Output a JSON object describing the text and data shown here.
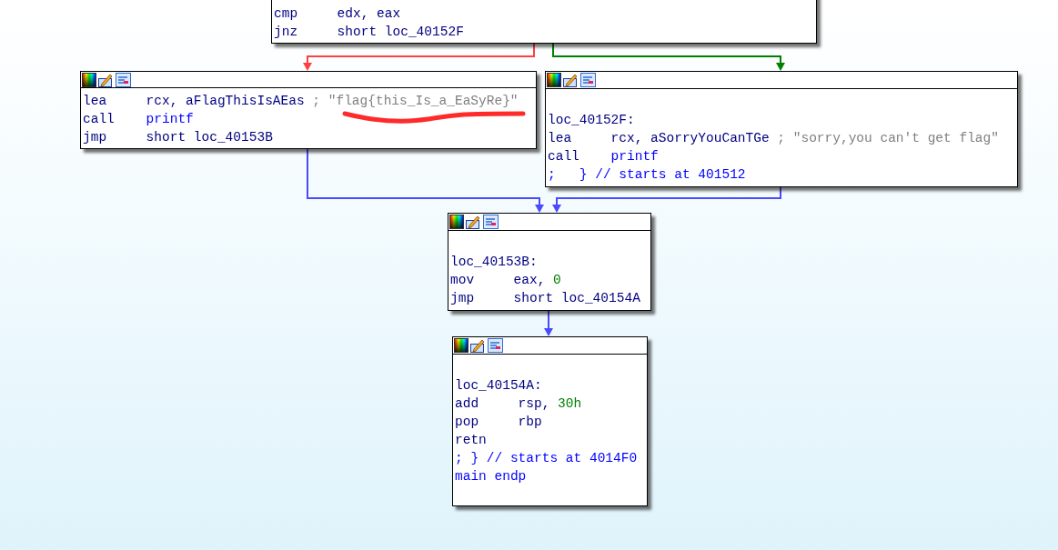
{
  "nodes": [
    {
      "lines": [
        {
          "kind": "instr",
          "mnemonic": "cmp",
          "operands": [
            {
              "text": "edx, eax",
              "kind": "plain"
            }
          ]
        },
        {
          "kind": "instr",
          "mnemonic": "jnz",
          "operands": [
            {
              "text": "short loc_40152F",
              "kind": "plain"
            }
          ]
        }
      ]
    },
    {
      "lines": [
        {
          "kind": "instr",
          "mnemonic": "lea",
          "operands": [
            {
              "text": "rcx, aFlagThisIsAEas",
              "kind": "plain"
            }
          ],
          "comment": "; \"flag{this_Is_a_EaSyRe}\""
        },
        {
          "kind": "instr",
          "mnemonic": "call",
          "operands": [
            {
              "text": "printf",
              "kind": "func"
            }
          ]
        },
        {
          "kind": "instr",
          "mnemonic": "jmp",
          "operands": [
            {
              "text": "short loc_40153B",
              "kind": "plain"
            }
          ]
        }
      ]
    },
    {
      "lines": [
        {
          "kind": "blank"
        },
        {
          "kind": "label",
          "text": "loc_40152F:"
        },
        {
          "kind": "instr",
          "mnemonic": "lea",
          "operands": [
            {
              "text": "rcx, aSorryYouCanTGe",
              "kind": "plain"
            }
          ],
          "comment": "; \"sorry,you can't get flag\""
        },
        {
          "kind": "instr",
          "mnemonic": "call",
          "operands": [
            {
              "text": "printf",
              "kind": "func"
            }
          ]
        },
        {
          "kind": "note",
          "text": ";   } // starts at 401512"
        }
      ]
    },
    {
      "lines": [
        {
          "kind": "blank"
        },
        {
          "kind": "label",
          "text": "loc_40153B:"
        },
        {
          "kind": "instr",
          "mnemonic": "mov",
          "operands": [
            {
              "text": "eax,",
              "kind": "plain"
            },
            {
              "text": "0",
              "kind": "num"
            }
          ]
        },
        {
          "kind": "instr",
          "mnemonic": "jmp",
          "operands": [
            {
              "text": "short loc_40154A",
              "kind": "plain"
            }
          ]
        }
      ]
    },
    {
      "lines": [
        {
          "kind": "blank"
        },
        {
          "kind": "label",
          "text": "loc_40154A:"
        },
        {
          "kind": "instr",
          "mnemonic": "add",
          "operands": [
            {
              "text": "rsp,",
              "kind": "plain"
            },
            {
              "text": "30h",
              "kind": "num"
            }
          ]
        },
        {
          "kind": "instr",
          "mnemonic": "pop",
          "operands": [
            {
              "text": "rbp",
              "kind": "plain"
            }
          ]
        },
        {
          "kind": "instr",
          "mnemonic": "retn"
        },
        {
          "kind": "note",
          "text": "; } // starts at 4014F0"
        },
        {
          "kind": "note",
          "text": "main endp"
        },
        {
          "kind": "blank"
        }
      ]
    }
  ],
  "edges": [
    {
      "color": "#ff4040"
    },
    {
      "color": "#008000"
    },
    {
      "color": "#4a4aff"
    },
    {
      "color": "#4a4aff"
    },
    {
      "color": "#4a4aff"
    }
  ],
  "annotation": {
    "kind": "underline",
    "color": "#ff2a2a"
  }
}
